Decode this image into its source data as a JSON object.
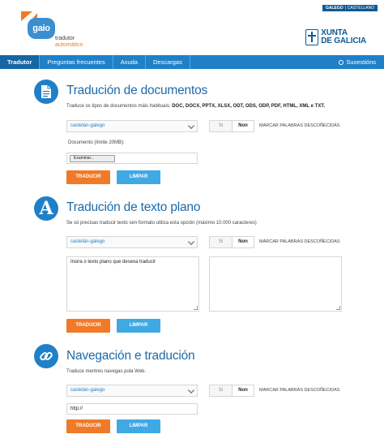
{
  "header": {
    "lang_galego": "GALEGO",
    "lang_sep": "|",
    "lang_castellano": "CASTELLANO",
    "logo_text": "gaio",
    "logo_sub1": "tradutor",
    "logo_sub2": "automático",
    "xunta_line1": "XUNTA",
    "xunta_line2": "DE GALICIA"
  },
  "nav": {
    "items": [
      "Tradutor",
      "Preguntas frecuentes",
      "Axuda",
      "Descargas"
    ],
    "suggest": "Suxestións"
  },
  "documents": {
    "title": "Tradución de documentos",
    "desc_prefix": "Traduce os tipos de documentos máis habituais: ",
    "desc_formats": "DOC, DOCX, PPTX, XLSX, ODT, ODS, ODP, PDF, HTML, XML e TXT.",
    "select_value": "castelán-galego",
    "toggle_si": "Si",
    "toggle_non": "Non",
    "mark_label": "MARCAR PALABRAS DESCOÑECIDAS",
    "file_label": "Documento (límite 20MB):",
    "file_button": "Examinar...",
    "translate": "TRADUCIR",
    "clear": "LIMPAR"
  },
  "plain_text": {
    "title": "Tradución de texto plano",
    "desc": "Se só precisas traducir texto sen formato utiliza esta opción (máximo 10.000 caracteres)",
    "select_value": "castelán-galego",
    "toggle_si": "Si",
    "toggle_non": "Non",
    "mark_label": "MARCAR PALABRAS DESCOÑECIDAS",
    "placeholder": "Insira o texto plano que desexa traducir",
    "translate": "TRADUCIR",
    "clear": "LIMPAR"
  },
  "web": {
    "title": "Navegación e tradución",
    "desc": "Traduce mentres navegas pola Web.",
    "select_value": "castelán-galego",
    "toggle_si": "Si",
    "toggle_non": "Non",
    "mark_label": "MARCAR PALABRAS DESCOÑECIDAS",
    "url_value": "http://",
    "translate": "TRADUCIR",
    "clear": "LIMPAR"
  },
  "colors": {
    "brand_blue": "#1f80c8",
    "title_blue": "#1d6aa8",
    "accent_orange": "#f07a28",
    "button_blue": "#3fa9e4"
  }
}
